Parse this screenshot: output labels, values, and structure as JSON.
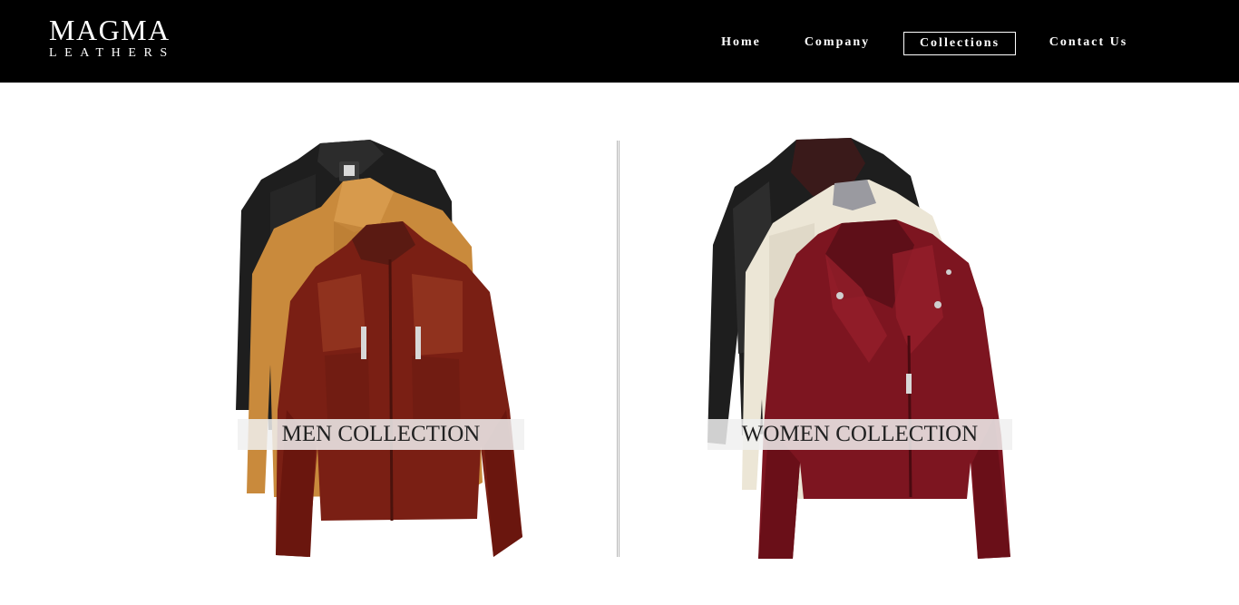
{
  "brand": {
    "name": "MAGMA",
    "tagline": "LEATHERS"
  },
  "nav": {
    "items": [
      {
        "label": "Home",
        "active": false
      },
      {
        "label": "Company",
        "active": false
      },
      {
        "label": "Collections",
        "active": true
      },
      {
        "label": "Contact Us",
        "active": false
      }
    ]
  },
  "collections": {
    "men": {
      "label": "MEN COLLECTION"
    },
    "women": {
      "label": "WOMEN COLLECTION"
    }
  },
  "colors": {
    "header_bg": "#000000",
    "leather_red": "#7a1f14",
    "leather_tan": "#c98a3c",
    "leather_black": "#1e1e1e",
    "leather_cream": "#ece6d6",
    "women_red": "#7d1520"
  }
}
